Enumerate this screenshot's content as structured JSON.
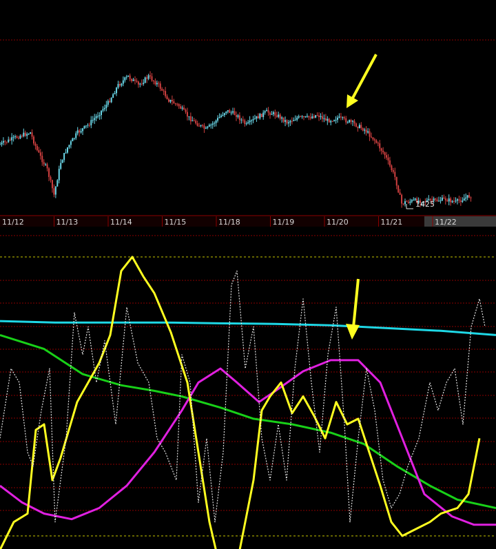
{
  "colors": {
    "background": "#000000",
    "grid_red": "#8b0000",
    "grid_yellow": "#c8c800",
    "axis_bar": "#1a0000",
    "candle_up": "#6ad7e8",
    "candle_down": "#d04040",
    "cyan": "#1ed8e6",
    "green": "#18d018",
    "magenta": "#e020e0",
    "yellow": "#ffff20",
    "white_dotted": "#e6e6e6",
    "arrow": "#ffff20",
    "highlight_date_bg": "#3a3a3a"
  },
  "chart_data": [
    {
      "type": "candlestick",
      "panel": "price",
      "x_labels": [
        "11/12",
        "11/13",
        "11/14",
        "11/15",
        "11/18",
        "11/19",
        "11/20",
        "11/21",
        "11/22"
      ],
      "highlighted_label": "11/22",
      "price_marker": "1425",
      "close_path": [
        [
          0,
          0.58
        ],
        [
          0.15,
          0.55
        ],
        [
          0.3,
          0.52
        ],
        [
          0.45,
          0.5
        ],
        [
          0.55,
          0.62
        ],
        [
          0.7,
          0.75
        ],
        [
          0.8,
          0.92
        ],
        [
          0.9,
          0.7
        ],
        [
          1.0,
          0.6
        ],
        [
          1.15,
          0.5
        ],
        [
          1.3,
          0.45
        ],
        [
          1.45,
          0.38
        ],
        [
          1.6,
          0.3
        ],
        [
          1.75,
          0.18
        ],
        [
          1.9,
          0.12
        ],
        [
          2.05,
          0.18
        ],
        [
          2.2,
          0.12
        ],
        [
          2.35,
          0.18
        ],
        [
          2.5,
          0.28
        ],
        [
          2.65,
          0.32
        ],
        [
          2.8,
          0.4
        ],
        [
          2.95,
          0.45
        ],
        [
          3.05,
          0.48
        ],
        [
          3.2,
          0.42
        ],
        [
          3.35,
          0.35
        ],
        [
          3.5,
          0.38
        ],
        [
          3.65,
          0.45
        ],
        [
          3.8,
          0.4
        ],
        [
          3.95,
          0.36
        ],
        [
          4.1,
          0.38
        ],
        [
          4.25,
          0.43
        ],
        [
          4.4,
          0.4
        ],
        [
          4.55,
          0.4
        ],
        [
          4.7,
          0.38
        ],
        [
          4.85,
          0.42
        ],
        [
          5.0,
          0.4
        ],
        [
          5.2,
          0.43
        ],
        [
          5.4,
          0.48
        ],
        [
          5.55,
          0.55
        ],
        [
          5.7,
          0.65
        ],
        [
          5.85,
          0.8
        ],
        [
          5.95,
          0.98
        ],
        [
          6.0,
          0.97
        ],
        [
          6.15,
          0.96
        ],
        [
          6.3,
          0.96
        ],
        [
          6.45,
          0.96
        ],
        [
          6.6,
          0.95
        ],
        [
          6.75,
          0.97
        ],
        [
          6.9,
          0.94
        ],
        [
          7.0,
          0.92
        ]
      ]
    },
    {
      "type": "line",
      "panel": "indicator",
      "guide_levels": [
        "upper",
        "lower"
      ],
      "series": [
        {
          "name": "",
          "color": "cyan",
          "style": "solid",
          "values": [
            [
              0,
              0.77
            ],
            [
              1,
              0.765
            ],
            [
              2,
              0.765
            ],
            [
              3,
              0.765
            ],
            [
              4,
              0.762
            ],
            [
              5,
              0.76
            ],
            [
              6,
              0.755
            ],
            [
              7,
              0.745
            ],
            [
              8,
              0.735
            ],
            [
              9,
              0.72
            ]
          ]
        },
        {
          "name": "",
          "color": "green",
          "style": "solid",
          "values": [
            [
              0,
              0.72
            ],
            [
              0.8,
              0.67
            ],
            [
              1.5,
              0.58
            ],
            [
              2.2,
              0.54
            ],
            [
              2.8,
              0.52
            ],
            [
              3.3,
              0.5
            ],
            [
              4.0,
              0.46
            ],
            [
              4.6,
              0.42
            ],
            [
              5.3,
              0.4
            ],
            [
              6.0,
              0.37
            ],
            [
              6.6,
              0.33
            ],
            [
              7.2,
              0.25
            ],
            [
              7.8,
              0.18
            ],
            [
              8.3,
              0.13
            ],
            [
              9.0,
              0.1
            ]
          ]
        },
        {
          "name": "",
          "color": "magenta",
          "style": "solid",
          "values": [
            [
              0,
              0.18
            ],
            [
              0.4,
              0.12
            ],
            [
              0.8,
              0.08
            ],
            [
              1.3,
              0.06
            ],
            [
              1.8,
              0.1
            ],
            [
              2.3,
              0.18
            ],
            [
              2.8,
              0.3
            ],
            [
              3.3,
              0.45
            ],
            [
              3.6,
              0.55
            ],
            [
              4.0,
              0.6
            ],
            [
              4.3,
              0.55
            ],
            [
              4.7,
              0.48
            ],
            [
              5.0,
              0.52
            ],
            [
              5.5,
              0.59
            ],
            [
              6.0,
              0.63
            ],
            [
              6.5,
              0.63
            ],
            [
              6.9,
              0.55
            ],
            [
              7.3,
              0.35
            ],
            [
              7.7,
              0.15
            ],
            [
              8.2,
              0.07
            ],
            [
              8.6,
              0.04
            ],
            [
              9.0,
              0.04
            ]
          ]
        },
        {
          "name": "",
          "color": "yellow",
          "style": "solid",
          "values": [
            [
              0,
              -0.05
            ],
            [
              0.25,
              0.05
            ],
            [
              0.5,
              0.08
            ],
            [
              0.65,
              0.38
            ],
            [
              0.8,
              0.4
            ],
            [
              0.95,
              0.2
            ],
            [
              1.1,
              0.28
            ],
            [
              1.4,
              0.48
            ],
            [
              1.8,
              0.62
            ],
            [
              2.0,
              0.72
            ],
            [
              2.2,
              0.95
            ],
            [
              2.4,
              1.0
            ],
            [
              2.6,
              0.93
            ],
            [
              2.8,
              0.87
            ],
            [
              3.1,
              0.73
            ],
            [
              3.4,
              0.55
            ],
            [
              3.6,
              0.3
            ],
            [
              3.8,
              0.05
            ],
            [
              4.0,
              -0.12
            ],
            [
              4.3,
              -0.1
            ],
            [
              4.6,
              0.2
            ],
            [
              4.75,
              0.45
            ],
            [
              4.9,
              0.5
            ],
            [
              5.1,
              0.55
            ],
            [
              5.3,
              0.44
            ],
            [
              5.5,
              0.5
            ],
            [
              5.7,
              0.43
            ],
            [
              5.9,
              0.35
            ],
            [
              6.1,
              0.48
            ],
            [
              6.3,
              0.4
            ],
            [
              6.5,
              0.42
            ],
            [
              6.7,
              0.3
            ],
            [
              6.9,
              0.18
            ],
            [
              7.1,
              0.05
            ],
            [
              7.3,
              0.0
            ],
            [
              7.5,
              0.02
            ],
            [
              7.8,
              0.05
            ],
            [
              8.0,
              0.08
            ],
            [
              8.3,
              0.1
            ],
            [
              8.5,
              0.15
            ],
            [
              8.7,
              0.35
            ]
          ]
        },
        {
          "name": "",
          "color": "white_dotted",
          "style": "dotted",
          "values": [
            [
              0,
              0.35
            ],
            [
              0.2,
              0.6
            ],
            [
              0.35,
              0.55
            ],
            [
              0.5,
              0.3
            ],
            [
              0.6,
              0.25
            ],
            [
              0.75,
              0.45
            ],
            [
              0.9,
              0.6
            ],
            [
              1.0,
              0.05
            ],
            [
              1.2,
              0.35
            ],
            [
              1.35,
              0.8
            ],
            [
              1.5,
              0.65
            ],
            [
              1.6,
              0.75
            ],
            [
              1.75,
              0.55
            ],
            [
              1.9,
              0.7
            ],
            [
              2.1,
              0.4
            ],
            [
              2.3,
              0.82
            ],
            [
              2.5,
              0.62
            ],
            [
              2.7,
              0.55
            ],
            [
              2.85,
              0.35
            ],
            [
              3.0,
              0.3
            ],
            [
              3.2,
              0.2
            ],
            [
              3.3,
              0.65
            ],
            [
              3.45,
              0.55
            ],
            [
              3.6,
              0.12
            ],
            [
              3.75,
              0.35
            ],
            [
              3.9,
              0.05
            ],
            [
              4.05,
              0.3
            ],
            [
              4.2,
              0.9
            ],
            [
              4.3,
              0.95
            ],
            [
              4.45,
              0.6
            ],
            [
              4.6,
              0.75
            ],
            [
              4.75,
              0.35
            ],
            [
              4.9,
              0.2
            ],
            [
              5.05,
              0.4
            ],
            [
              5.2,
              0.2
            ],
            [
              5.35,
              0.6
            ],
            [
              5.5,
              0.85
            ],
            [
              5.65,
              0.55
            ],
            [
              5.8,
              0.3
            ],
            [
              5.95,
              0.65
            ],
            [
              6.1,
              0.82
            ],
            [
              6.25,
              0.4
            ],
            [
              6.35,
              0.05
            ],
            [
              6.5,
              0.35
            ],
            [
              6.65,
              0.6
            ],
            [
              6.8,
              0.45
            ],
            [
              6.95,
              0.2
            ],
            [
              7.1,
              0.1
            ],
            [
              7.25,
              0.15
            ],
            [
              7.4,
              0.25
            ],
            [
              7.6,
              0.35
            ],
            [
              7.8,
              0.55
            ],
            [
              7.95,
              0.45
            ],
            [
              8.1,
              0.55
            ],
            [
              8.25,
              0.6
            ],
            [
              8.4,
              0.4
            ],
            [
              8.55,
              0.75
            ],
            [
              8.7,
              0.85
            ],
            [
              8.8,
              0.75
            ]
          ]
        }
      ]
    }
  ],
  "annotations": [
    {
      "type": "arrow",
      "panel": "price",
      "target": "11/20 peak",
      "direction": "down-left"
    },
    {
      "type": "arrow",
      "panel": "indicator",
      "target": "magenta peak",
      "direction": "down"
    }
  ]
}
